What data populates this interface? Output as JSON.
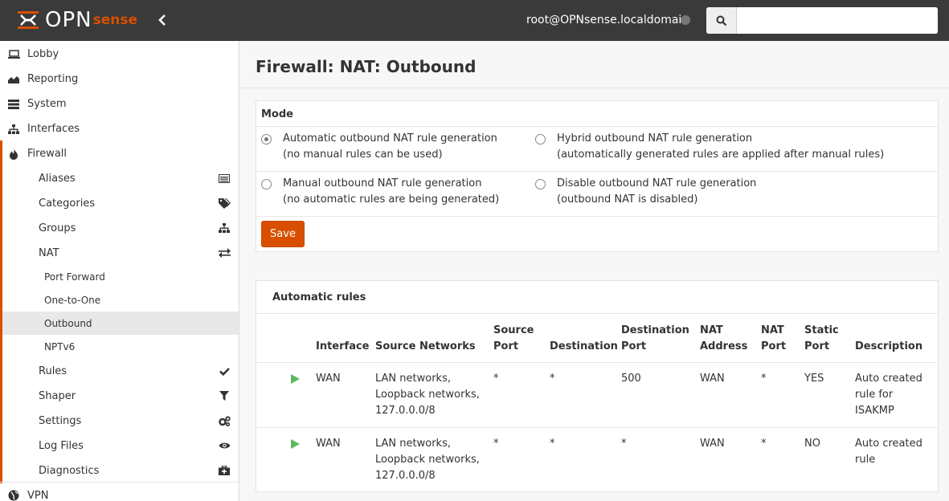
{
  "header": {
    "logo_main": "OPN",
    "logo_sense": "sense",
    "user": "root@OPNsense.localdomain",
    "search": {
      "placeholder": "",
      "value": ""
    }
  },
  "sidebar": {
    "lobby": "Lobby",
    "reporting": "Reporting",
    "system": "System",
    "interfaces": "Interfaces",
    "firewall": "Firewall",
    "firewall_items": {
      "aliases": "Aliases",
      "categories": "Categories",
      "groups": "Groups",
      "nat": "NAT",
      "nat_items": {
        "port_forward": "Port Forward",
        "one_to_one": "One-to-One",
        "outbound": "Outbound",
        "nptv6": "NPTv6"
      },
      "rules": "Rules",
      "shaper": "Shaper",
      "settings": "Settings",
      "log_files": "Log Files",
      "diagnostics": "Diagnostics"
    },
    "vpn": "VPN"
  },
  "page": {
    "title": "Firewall: NAT: Outbound"
  },
  "mode": {
    "heading": "Mode",
    "options": {
      "automatic": {
        "label": "Automatic outbound NAT rule generation",
        "note": "(no manual rules can be used)",
        "checked": true
      },
      "hybrid": {
        "label": "Hybrid outbound NAT rule generation",
        "note": "(automatically generated rules are applied after manual rules)",
        "checked": false
      },
      "manual": {
        "label": "Manual outbound NAT rule generation",
        "note": "(no automatic rules are being generated)",
        "checked": false
      },
      "disable": {
        "label": "Disable outbound NAT rule generation",
        "note": "(outbound NAT is disabled)",
        "checked": false
      }
    },
    "save_label": "Save"
  },
  "auto_rules": {
    "heading": "Automatic rules",
    "columns": {
      "interface": "Interface",
      "source_networks": "Source Networks",
      "source_port_1": "Source",
      "source_port_2": "Port",
      "destination": "Destination",
      "destination_port_1": "Destination",
      "destination_port_2": "Port",
      "nat_address_1": "NAT",
      "nat_address_2": "Address",
      "nat_port_1": "NAT",
      "nat_port_2": "Port",
      "static_port_1": "Static",
      "static_port_2": "Port",
      "description": "Description"
    },
    "rows": [
      {
        "interface": "WAN",
        "source_1": "LAN networks,",
        "source_2": "Loopback networks,",
        "source_3": "127.0.0.0/8",
        "source_port": "*",
        "destination": "*",
        "destination_port": "500",
        "nat_address": "WAN",
        "nat_port": "*",
        "static_port": "YES",
        "description_1": "Auto created",
        "description_2": "rule for",
        "description_3": "ISAKMP"
      },
      {
        "interface": "WAN",
        "source_1": "LAN networks,",
        "source_2": "Loopback networks,",
        "source_3": "127.0.0.0/8",
        "source_port": "*",
        "destination": "*",
        "destination_port": "*",
        "nat_address": "WAN",
        "nat_port": "*",
        "static_port": "NO",
        "description_1": "Auto created",
        "description_2": "rule",
        "description_3": ""
      }
    ]
  },
  "colors": {
    "accent": "#d94f00",
    "header_bg": "#3a3a3a",
    "play_green": "#5cb85c"
  }
}
